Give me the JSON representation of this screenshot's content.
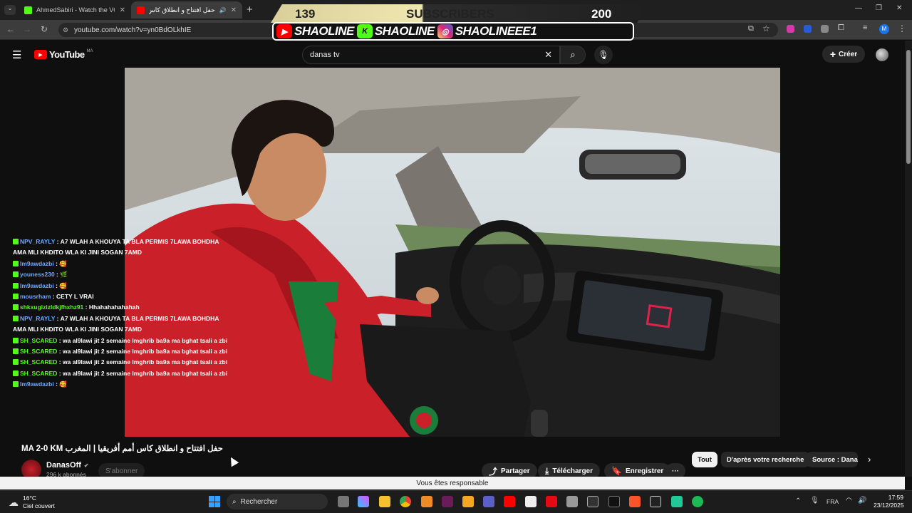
{
  "browser": {
    "tabs": [
      {
        "title": "AhmedSabiri - Watch the VOD",
        "active": false,
        "favicon_color": "#53fc18"
      },
      {
        "title": "حفل افتتاح و انطلاق كاس أم",
        "active": true,
        "favicon_color": "#ff0000"
      }
    ],
    "url": "youtube.com/watch?v=yn0BdOLkhIE",
    "profile_initial": "M"
  },
  "overlay": {
    "left_count": "139",
    "label": "SUBSCRIBERS",
    "right_count": "200",
    "socials": [
      {
        "icon": "youtube-icon",
        "name": "SHAOLINE",
        "color": "#ff0000"
      },
      {
        "icon": "kick-icon",
        "name": "SHAOLINE",
        "color": "#53fc18"
      },
      {
        "icon": "instagram-icon",
        "name": "SHAOLINEEE1",
        "color": "#d62976"
      }
    ]
  },
  "youtube": {
    "logo_text": "YouTube",
    "region": "MA",
    "search_value": "danas tv",
    "create_label": "Créer"
  },
  "chat": [
    {
      "user": "NPV_RAYLY",
      "color": "#6ea8ff",
      "msg": "A7 WLAH A KHOUYA TA BLA PERMIS 7LAWA BOHDHA AMA MLI KHDITO WLA KI JINI SOGAN 7AMD"
    },
    {
      "user": "lm9awdazbi",
      "color": "#6ea8ff",
      "msg": "🥰"
    },
    {
      "user": "youness230",
      "color": "#6ea8ff",
      "msg": "🌿"
    },
    {
      "user": "lm9awdazbi",
      "color": "#6ea8ff",
      "msg": "🥰"
    },
    {
      "user": "mousrham",
      "color": "#6ea8ff",
      "msg": "CETY L VRAI"
    },
    {
      "user": "shkxugizizldkjfhxhz91",
      "color": "#53fc18",
      "msg": "Hhahahahahahah"
    },
    {
      "user": "NPV_RAYLY",
      "color": "#6ea8ff",
      "msg": "A7 WLAH A KHOUYA TA BLA PERMIS 7LAWA BOHDHA AMA MLI KHDITO WLA KI JINI SOGAN 7AMD"
    },
    {
      "user": "SH_SCARED",
      "color": "#53fc18",
      "msg": "wa al9lawi jit 2 semaine lmghrib ba9a ma bghat tsali a zbi"
    },
    {
      "user": "SH_SCARED",
      "color": "#53fc18",
      "msg": "wa al9lawi jit 2 semaine lmghrib ba9a ma bghat tsali a zbi"
    },
    {
      "user": "SH_SCARED",
      "color": "#53fc18",
      "msg": "wa al9lawi jit 2 semaine lmghrib ba9a ma bghat tsali a zbi"
    },
    {
      "user": "SH_SCARED",
      "color": "#53fc18",
      "msg": "wa al9lawi jit 2 semaine lmghrib ba9a ma bghat tsali a zbi"
    },
    {
      "user": "lm9awdazbi",
      "color": "#6ea8ff",
      "msg": "🥰"
    }
  ],
  "video_info": {
    "title": "حفل افتتاح و انطلاق كاس أمم أفريقيا | المغرب MA 2-0 KM",
    "channel": "DanasOff",
    "subscribers": "296 k abonnés",
    "subscribe_label": "S'abonner",
    "share_label": "Partager",
    "download_label": "Télécharger",
    "save_label": "Enregistrer",
    "more_label": "···"
  },
  "chips": [
    "Tout",
    "D'après votre recherche",
    "Source : Danas"
  ],
  "notice": "Vous êtes responsable",
  "taskbar": {
    "weather_temp": "16°C",
    "weather_desc": "Ciel couvert",
    "search_placeholder": "Rechercher",
    "lang": "FRA",
    "time": "17:59",
    "date": "23/12/2025"
  }
}
